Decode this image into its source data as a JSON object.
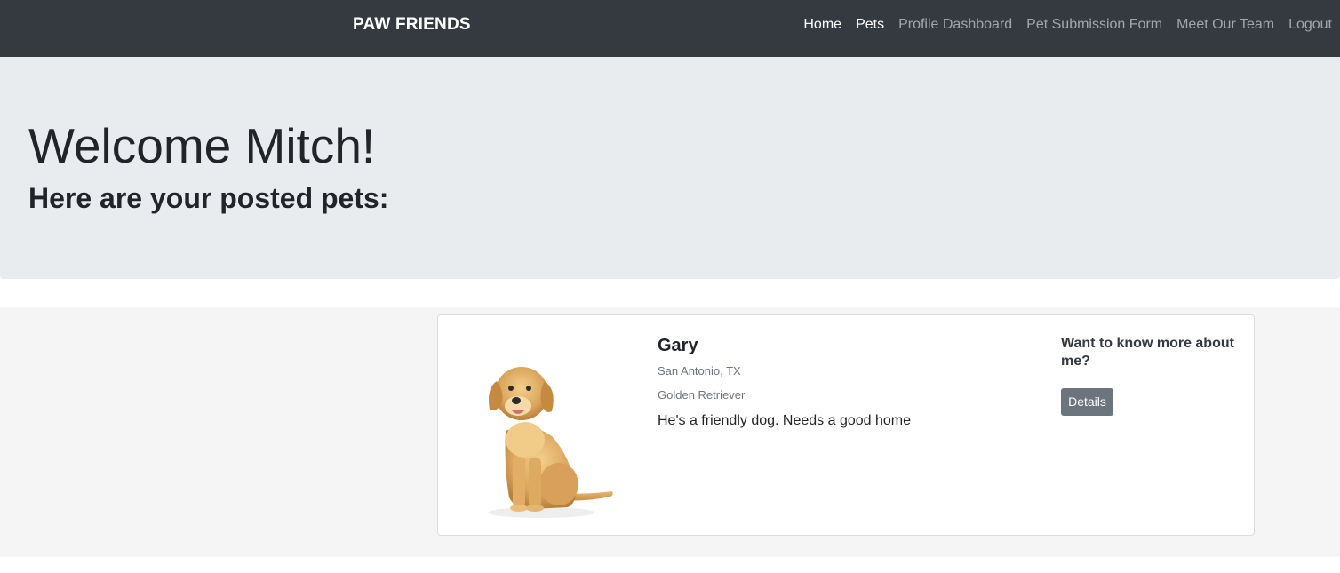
{
  "navbar": {
    "brand": "PAW FRIENDS",
    "links": [
      {
        "label": "Home",
        "active": true
      },
      {
        "label": "Pets",
        "active": true
      },
      {
        "label": "Profile Dashboard",
        "active": false
      },
      {
        "label": "Pet Submission Form",
        "active": false
      },
      {
        "label": "Meet Our Team",
        "active": false
      },
      {
        "label": "Logout",
        "active": false
      }
    ]
  },
  "jumbotron": {
    "welcome": "Welcome Mitch!",
    "subtitle": "Here are your posted pets:"
  },
  "pets": [
    {
      "name": "Gary",
      "location": "San Antonio, TX",
      "breed": "Golden Retriever",
      "description": "He's a friendly dog. Needs a good home",
      "more_heading": "Want to know more about me?",
      "details_label": "Details",
      "photo_icon": "golden-retriever-puppy"
    }
  ],
  "colors": {
    "navbar_bg": "#343a40",
    "jumbotron_bg": "#e9ecef",
    "section_bg": "#f5f5f5",
    "button_bg": "#6c757d"
  }
}
